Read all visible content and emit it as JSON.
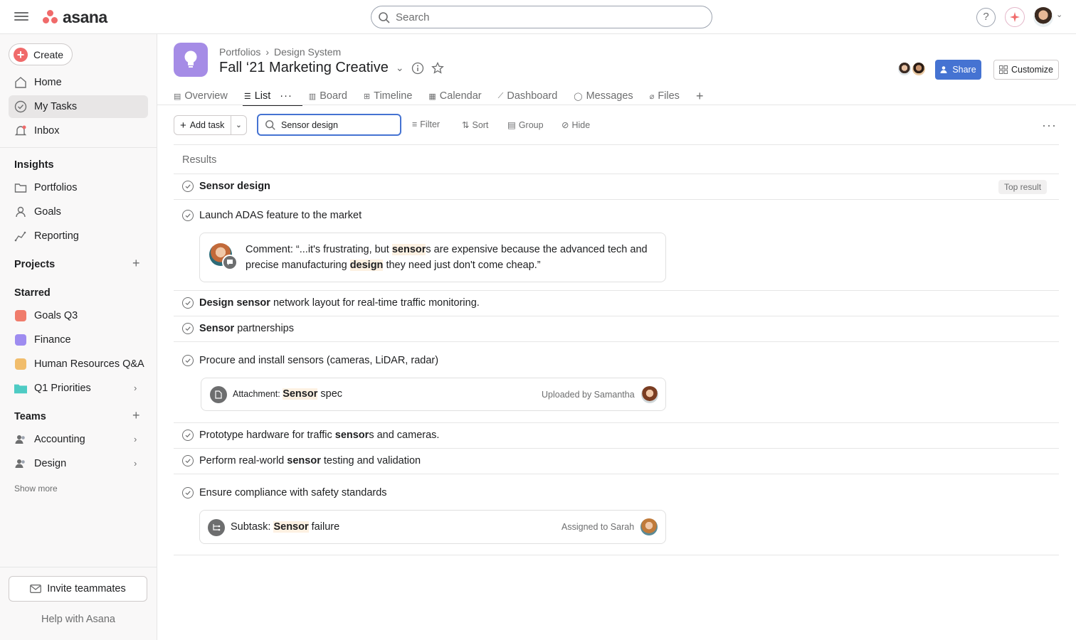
{
  "app": {
    "name": "asana"
  },
  "search": {
    "placeholder": "Search"
  },
  "sidebar": {
    "create_label": "Create",
    "nav": [
      {
        "label": "Home",
        "icon": "home-icon"
      },
      {
        "label": "My Tasks",
        "icon": "check-circle-icon",
        "active": true
      },
      {
        "label": "Inbox",
        "icon": "bell-icon"
      }
    ],
    "insights": {
      "title": "Insights",
      "items": [
        {
          "label": "Portfolios"
        },
        {
          "label": "Goals"
        },
        {
          "label": "Reporting"
        }
      ]
    },
    "projects": {
      "title": "Projects"
    },
    "starred": {
      "title": "Starred",
      "items": [
        {
          "label": "Goals Q3",
          "color": "#f07c6c"
        },
        {
          "label": "Finance",
          "color": "#9e8cf0"
        },
        {
          "label": "Human Resources Q&A",
          "color": "#f1bd6c"
        },
        {
          "label": "Q1 Priorities",
          "color": "#4ecbc4"
        }
      ]
    },
    "teams": {
      "title": "Teams",
      "items": [
        {
          "label": "Accounting"
        },
        {
          "label": "Design"
        }
      ]
    },
    "show_more": "Show more",
    "invite": "Invite teammates",
    "help": "Help with Asana"
  },
  "project": {
    "breadcrumb": [
      "Portfolios",
      "Design System"
    ],
    "title": "Fall ‘21 Marketing Creative",
    "icon_color": "#a58ce6",
    "share_label": "Share",
    "customize_label": "Customize",
    "tabs": [
      {
        "label": "Overview"
      },
      {
        "label": "List",
        "active": true
      },
      {
        "label": "Board"
      },
      {
        "label": "Timeline"
      },
      {
        "label": "Calendar"
      },
      {
        "label": "Dashboard"
      },
      {
        "label": "Messages"
      },
      {
        "label": "Files"
      }
    ]
  },
  "toolbar": {
    "add_task": "Add task",
    "search_value": "Sensor design",
    "filter": "Filter",
    "sort": "Sort",
    "group": "Group",
    "hide": "Hide"
  },
  "results": {
    "heading": "Results",
    "top_result_badge": "Top result",
    "items": [
      {
        "parts": [
          {
            "t": "Sensor design",
            "b": true
          }
        ]
      },
      {
        "parts": [
          {
            "t": "Launch ADAS feature to the market"
          }
        ],
        "comment": [
          {
            "t": "Comment: “...it's frustrating, but "
          },
          {
            "t": "sensor",
            "hl": true
          },
          {
            "t": "s are expensive because the advanced tech and precise manufacturing "
          },
          {
            "t": "design",
            "hl": true
          },
          {
            "t": " they need just don't come cheap.”"
          }
        ]
      },
      {
        "parts": [
          {
            "t": "Design sensor",
            "b": true
          },
          {
            "t": " network layout for real-time traffic monitoring."
          }
        ]
      },
      {
        "parts": [
          {
            "t": "Sensor",
            "b": true
          },
          {
            "t": " partnerships"
          }
        ]
      },
      {
        "parts": [
          {
            "t": "Procure and install sensors (cameras, LiDAR, radar)"
          }
        ],
        "attachment": {
          "prefix": "Attachment: ",
          "hl": "Sensor",
          "suffix": " spec",
          "meta": "Uploaded by Samantha"
        }
      },
      {
        "parts": [
          {
            "t": "Prototype hardware for traffic "
          },
          {
            "t": "sensor",
            "b": true
          },
          {
            "t": "s and cameras."
          }
        ]
      },
      {
        "parts": [
          {
            "t": "Perform real-world "
          },
          {
            "t": "sensor",
            "b": true
          },
          {
            "t": " testing and validation"
          }
        ]
      },
      {
        "parts": [
          {
            "t": "Ensure compliance with safety standards"
          }
        ],
        "subtask": {
          "prefix": "Subtask: ",
          "hl": "Sensor",
          "suffix": " failure",
          "meta": "Assigned to Sarah"
        }
      }
    ]
  }
}
